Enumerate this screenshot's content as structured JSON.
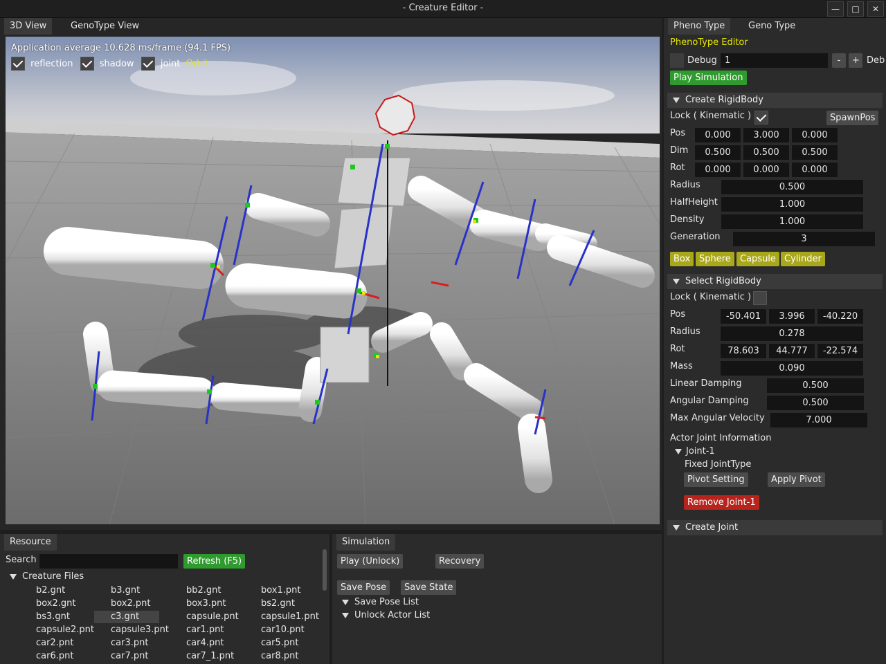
{
  "window": {
    "title": "- Creature Editor -",
    "minimize_icon": "minimize-icon",
    "maximize_icon": "maximize-icon",
    "close_icon": "close-icon"
  },
  "left_tabs": [
    "3D View",
    "GenoType View"
  ],
  "viewport": {
    "fps_text": "Application average 10.628 ms/frame (94.1 FPS)",
    "toggles": [
      {
        "label": "reflection",
        "checked": true
      },
      {
        "label": "shadow",
        "checked": true
      },
      {
        "label": "joint",
        "checked": true
      }
    ],
    "mode": "Orbit",
    "colors": {
      "sky_top": "#8fa0c0",
      "floor": "#8b8b8b",
      "mode_text": "#e6e600"
    }
  },
  "right_tabs": [
    "Pheno Type",
    "Geno Type"
  ],
  "pheno": {
    "title": "PhenoType Editor",
    "debug_label": "Debug",
    "debug_value": "1",
    "minus": "-",
    "plus": "+",
    "debug_trailing": "Deb",
    "play_simulation": "Play Simulation",
    "create_rigidbody": {
      "header": "Create RigidBody",
      "lock_label": "Lock ( Kinematic )",
      "lock_checked": true,
      "spawn_pos": "SpawnPos",
      "rows": [
        {
          "label": "Pos",
          "values": [
            "0.000",
            "3.000",
            "0.000"
          ]
        },
        {
          "label": "Dim",
          "values": [
            "0.500",
            "0.500",
            "0.500"
          ]
        },
        {
          "label": "Rot",
          "values": [
            "0.000",
            "0.000",
            "0.000"
          ]
        }
      ],
      "single_rows": [
        {
          "label": "Radius",
          "value": "0.500"
        },
        {
          "label": "HalfHeight",
          "value": "1.000"
        },
        {
          "label": "Density",
          "value": "1.000"
        },
        {
          "label": "Generation",
          "value": "3"
        }
      ],
      "shapes": [
        "Box",
        "Sphere",
        "Capsule",
        "Cylinder"
      ]
    },
    "select_rigidbody": {
      "header": "Select RigidBody",
      "lock_label": "Lock ( Kinematic )",
      "lock_checked": false,
      "pos_label": "Pos",
      "pos_values": [
        "-50.401",
        "3.996",
        "-40.220"
      ],
      "radius_label": "Radius",
      "radius_value": "0.278",
      "rot_label": "Rot",
      "rot_values": [
        "78.603",
        "44.777",
        "-22.574"
      ],
      "mass_label": "Mass",
      "mass_value": "0.090",
      "linear_damping_label": "Linear Damping",
      "linear_damping_value": "0.500",
      "angular_damping_label": "Angular Damping",
      "angular_damping_value": "0.500",
      "max_ang_vel_label": "Max Angular Velocity",
      "max_ang_vel_value": "7.000",
      "actor_joint_info": "Actor Joint Information",
      "joint_name": "Joint-1",
      "joint_type": "Fixed JointType",
      "pivot_setting": "Pivot Setting",
      "apply_pivot": "Apply Pivot",
      "remove_joint": "Remove Joint-1"
    },
    "create_joint": "Create Joint"
  },
  "resource": {
    "tab": "Resource",
    "search_label": "Search",
    "search_value": "",
    "refresh": "Refresh (F5)",
    "folder": "Creature Files",
    "files": [
      [
        "b2.gnt",
        "b3.gnt",
        "bb2.gnt",
        "box1.pnt"
      ],
      [
        "box2.gnt",
        "box2.pnt",
        "box3.pnt",
        "bs2.gnt"
      ],
      [
        "bs3.gnt",
        "c3.gnt",
        "capsule.pnt",
        "capsule1.pnt"
      ],
      [
        "capsule2.pnt",
        "capsule3.pnt",
        "car1.pnt",
        "car10.pnt"
      ],
      [
        "car2.pnt",
        "car3.pnt",
        "car4.pnt",
        "car5.pnt"
      ],
      [
        "car6.pnt",
        "car7.pnt",
        "car7_1.pnt",
        "car8.pnt"
      ]
    ],
    "selected": "c3.gnt"
  },
  "simulation": {
    "tab": "Simulation",
    "play": "Play (Unlock)",
    "recovery": "Recovery",
    "save_pose": "Save Pose",
    "save_state": "Save State",
    "save_pose_list": "Save Pose List",
    "unlock_actor_list": "Unlock Actor List"
  }
}
